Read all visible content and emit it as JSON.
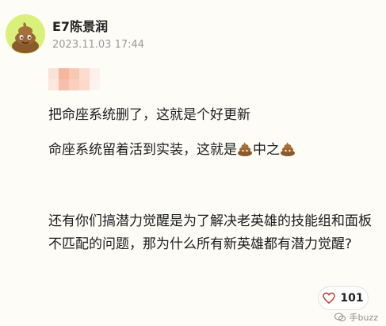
{
  "post": {
    "author": "E7陈景润",
    "timestamp": "2023.11.03 17:44",
    "lines": [
      "把命座系统删了，这就是个好更新",
      "命座系统留着活到实装，这就是",
      "中之"
    ],
    "paragraph2": "还有你们搞潜力觉醒是为了解决老英雄的技能组和面板不匹配的问题，那为什么所有新英雄都有潜力觉醒?",
    "like_count": "101"
  },
  "watermark": {
    "text": "手buzz"
  },
  "colors": {
    "background": "#fdfcf7",
    "avatar_bg": "#d9f07a",
    "poop": "#8b5a2b",
    "heart": "#c0392b"
  },
  "icons": {
    "avatar": "poop-avatar-icon",
    "emoji": "poop-emoji-icon",
    "like": "heart-icon",
    "watermark": "wechat-icon"
  }
}
